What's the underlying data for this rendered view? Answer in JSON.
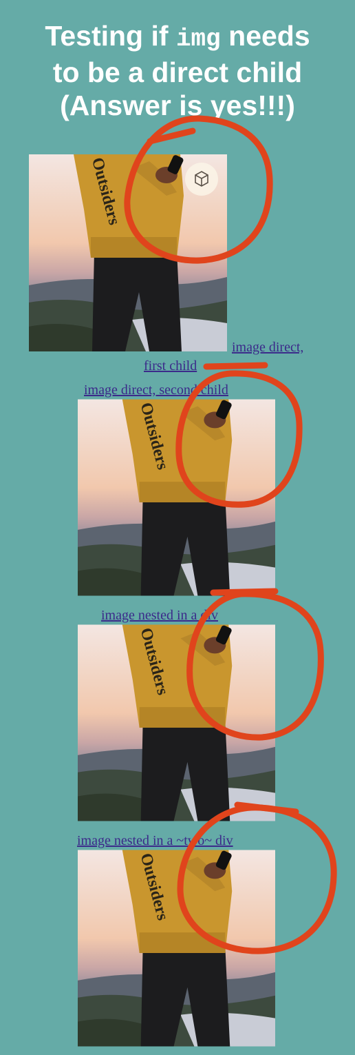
{
  "title": {
    "line1_prefix": "Testing if",
    "line1_code": "img",
    "line1_suffix": "needs",
    "line2": "to be a direct child",
    "line3": "(Answer is yes!!!)"
  },
  "links": {
    "first_line1": "image direct,",
    "first_line2": "first child",
    "second": "image direct, second child",
    "nested": "image nested in a div",
    "nested_two": "image nested in a ~two~ div"
  },
  "photo_text": "Outsiders",
  "icons": {
    "ar": "ar-view-icon",
    "annotation": "red-hand-drawn-circle"
  },
  "colors": {
    "background": "#65aba7",
    "title": "#ffffff",
    "link": "#3b2a8a",
    "annotation": "#e0441c"
  }
}
